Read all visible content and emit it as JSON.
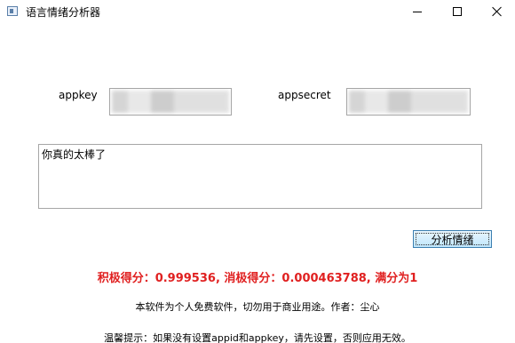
{
  "window": {
    "title": "语言情绪分析器",
    "icon": "app-window-icon",
    "controls": [
      "minimize",
      "maximize",
      "close"
    ]
  },
  "form": {
    "appkey_label": "appkey",
    "appsecret_label": "appsecret",
    "appkey_value_visible": "t 5",
    "appsecret_value_visible": ":::FsdVD'- 5",
    "input_text": "你真的太棒了",
    "analyze_button": "分析情绪"
  },
  "result": {
    "score_text": "积极得分：0.999536, 消极得分：0.000463788, 满分为1",
    "score_color": "#e02020"
  },
  "footer": {
    "notice": "本软件为个人免费软件，切勿用于商业用途。作者：尘心",
    "tip": "温馨提示：如果没有设置appid和appkey，请先设置，否则应用无效。"
  }
}
